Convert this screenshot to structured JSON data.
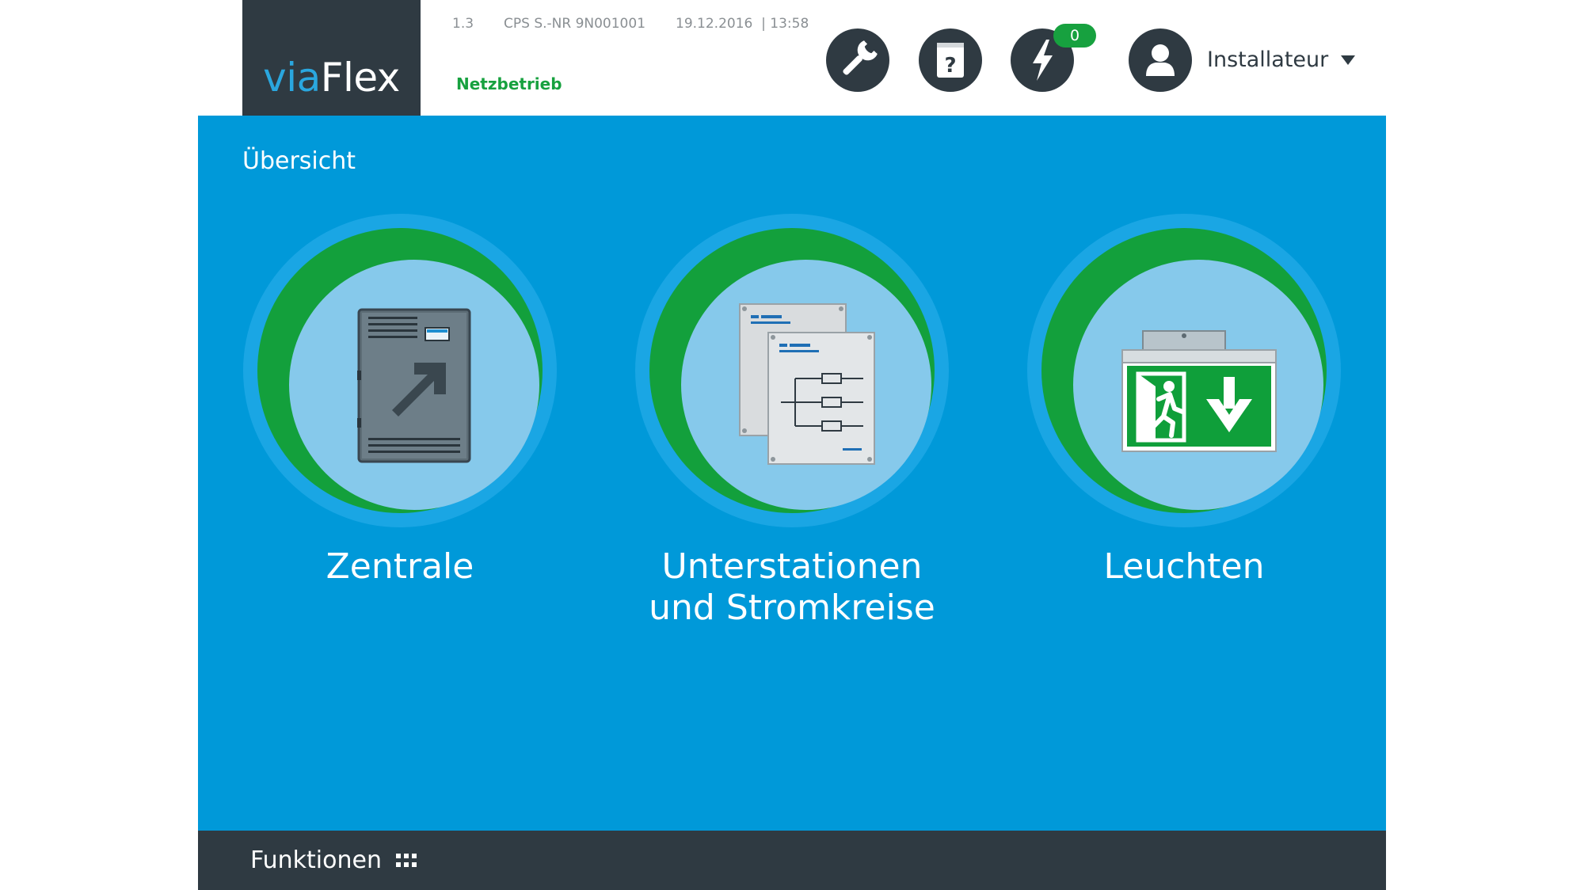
{
  "header": {
    "logo_prefix": "via",
    "logo_suffix": "Flex",
    "version": "1.3",
    "serial": "CPS S.-NR 9N001001",
    "datetime": "19.12.2016  | 13:58",
    "mode": "Netzbetrieb",
    "buttons": [
      {
        "icon": "wrench-icon"
      },
      {
        "icon": "help-manual-icon"
      },
      {
        "icon": "lightning-icon",
        "badge": "0"
      }
    ],
    "user": {
      "icon": "user-icon",
      "name": "Installateur"
    }
  },
  "main": {
    "title": "Übersicht",
    "tiles": [
      {
        "id": "zentrale",
        "icon": "control-cabinet-icon",
        "label": [
          "Zentrale"
        ],
        "status_color": "#13a03c"
      },
      {
        "id": "unterstationen",
        "icon": "circuit-diagram-icon",
        "label": [
          "Unterstationen",
          "und Stromkreise"
        ],
        "status_color": "#13a03c"
      },
      {
        "id": "leuchten",
        "icon": "exit-sign-icon",
        "label": [
          "Leuchten"
        ],
        "status_color": "#13a03c"
      }
    ]
  },
  "footer": {
    "label": "Funktionen",
    "icon": "grid-menu-icon"
  },
  "colors": {
    "accent_blue": "#0099d9",
    "dark": "#2f3a42",
    "status_green": "#13a03c"
  }
}
